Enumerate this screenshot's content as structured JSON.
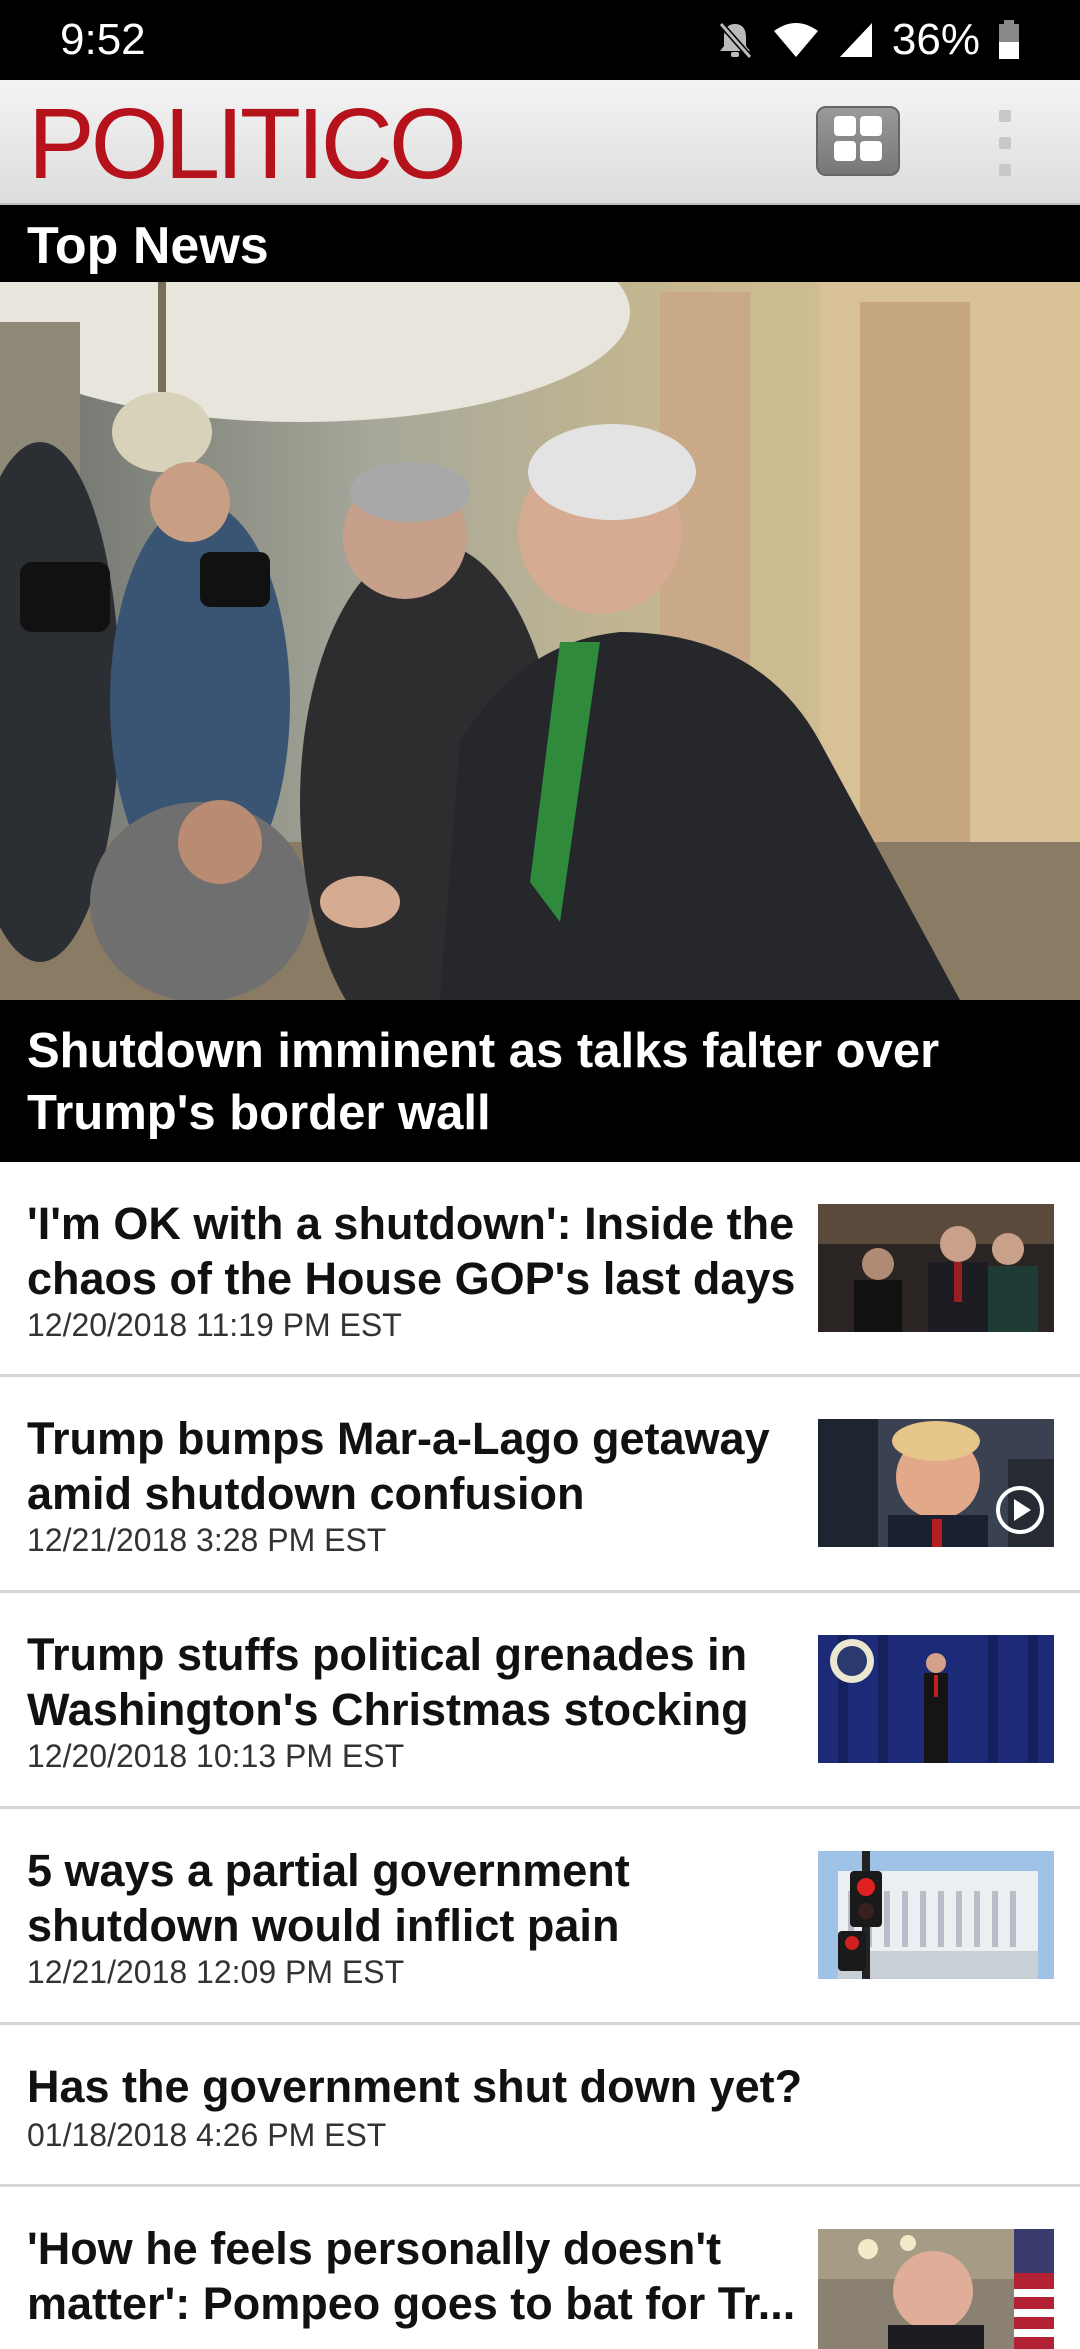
{
  "status_bar": {
    "time": "9:52",
    "battery": "36%",
    "icons": [
      "bell-off-icon",
      "wifi-icon",
      "signal-icon",
      "battery-icon"
    ]
  },
  "app_bar": {
    "logo": "POLITICO",
    "grid_button_icon": "grid-icon",
    "menu_button_icon": "overflow-menu-icon"
  },
  "section": {
    "title": "Top News"
  },
  "hero": {
    "headline": "Shutdown imminent as talks falter over Trump's border wall"
  },
  "articles": [
    {
      "headline": "'I'm OK with a shutdown': Inside the chaos of the House GOP's last days",
      "timestamp": "12/20/2018 11:19 PM EST",
      "has_thumbnail": true,
      "has_video": false
    },
    {
      "headline": "Trump bumps Mar-a-Lago getaway amid shutdown confusion",
      "timestamp": "12/21/2018 3:28 PM EST",
      "has_thumbnail": true,
      "has_video": true
    },
    {
      "headline": "Trump stuffs political grenades in Washington's Christmas stocking",
      "timestamp": "12/20/2018 10:13 PM EST",
      "has_thumbnail": true,
      "has_video": false
    },
    {
      "headline": "5 ways a partial government shutdown would inflict pain",
      "timestamp": "12/21/2018 12:09 PM EST",
      "has_thumbnail": true,
      "has_video": false
    },
    {
      "headline": "Has the government shut down yet?",
      "timestamp": "01/18/2018 4:26 PM EST",
      "has_thumbnail": false,
      "has_video": false
    },
    {
      "headline": "'How he feels personally doesn't matter': Pompeo goes to bat for Tr...",
      "timestamp": "",
      "has_thumbnail": true,
      "has_video": false
    }
  ],
  "colors": {
    "brand_red": "#b5121b",
    "header_black": "#000000",
    "divider": "#d6d6d6"
  }
}
